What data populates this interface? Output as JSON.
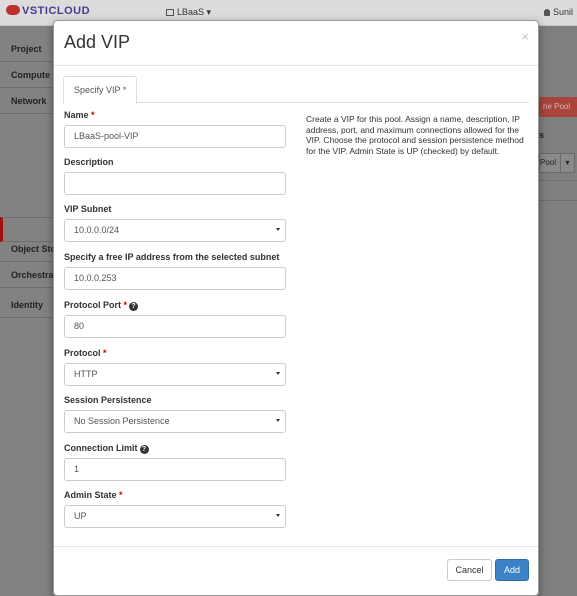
{
  "app": {
    "logo_text": "VSTICLOUD",
    "project_label": "LBaaS",
    "user_label": "Sunil"
  },
  "sidebar": {
    "items": [
      {
        "label": "Project"
      },
      {
        "label": "Compute"
      },
      {
        "label": "Network"
      },
      {
        "label": "Object Sto"
      },
      {
        "label": "Orchestrat"
      },
      {
        "label": "Identity"
      }
    ]
  },
  "background_page": {
    "add_pool_button": "ne Pool",
    "heading_fragment": "s",
    "dropdown_label": "Pool"
  },
  "modal": {
    "title": "Add VIP",
    "close_symbol": "×",
    "tab_label": "Specify VIP *",
    "description": "Create a VIP for this pool. Assign a name, description, IP address, port, and maximum connections allowed for the VIP. Choose the protocol and session persistence method for the VIP. Admin State is UP (checked) by default.",
    "fields": {
      "name": {
        "label": "Name",
        "required_mark": "*",
        "value": "LBaaS-pool-VIP"
      },
      "description": {
        "label": "Description",
        "value": ""
      },
      "vip_subnet": {
        "label": "VIP Subnet",
        "value": "10.0.0.0/24"
      },
      "ip_address": {
        "label": "Specify a free IP address from the selected subnet",
        "value": "10.0.0.253"
      },
      "protocol_port": {
        "label": "Protocol Port",
        "required_mark": "*",
        "value": "80"
      },
      "protocol": {
        "label": "Protocol",
        "required_mark": "*",
        "value": "HTTP"
      },
      "session_persistence": {
        "label": "Session Persistence",
        "value": "No Session Persistence"
      },
      "connection_limit": {
        "label": "Connection Limit",
        "value": "1"
      },
      "admin_state": {
        "label": "Admin State",
        "required_mark": "*",
        "value": "UP"
      }
    },
    "help_symbol": "?",
    "cancel_label": "Cancel",
    "add_label": "Add"
  },
  "colors": {
    "primary_button": "#3c82c7",
    "required_mark": "#cc0000",
    "overlay": "#7f7f7f"
  }
}
